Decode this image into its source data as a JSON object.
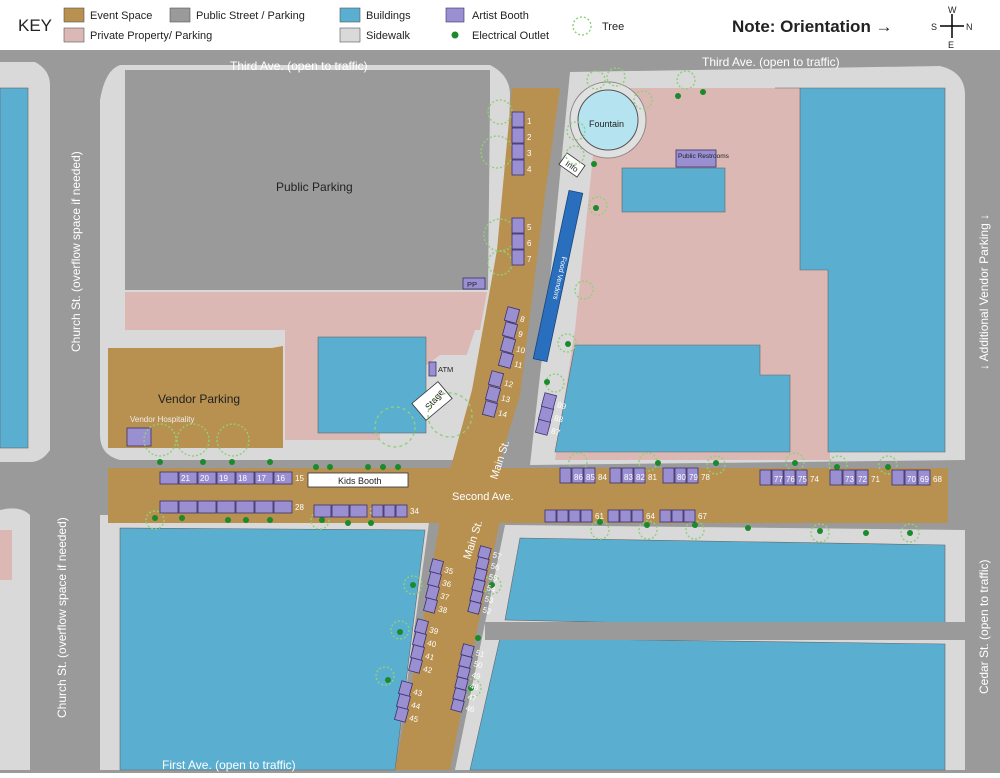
{
  "key": {
    "title": "KEY",
    "items": [
      {
        "label": "Event Space",
        "color": "#b8904f"
      },
      {
        "label": "Public Street / Parking",
        "color": "#9a9a9a"
      },
      {
        "label": "Buildings",
        "color": "#5aaed0"
      },
      {
        "label": "Artist Booth",
        "color": "#9a8fd0"
      },
      {
        "label": "Private Property/ Parking",
        "color": "#dcb8b4"
      },
      {
        "label": "Sidewalk",
        "color": "#d9d9d9"
      },
      {
        "label": "Electrical Outlet",
        "icon": "electrical-outlet-icon"
      },
      {
        "label": "Tree",
        "icon": "tree-icon"
      }
    ],
    "orientation_note": "Note: Orientation →",
    "compass": {
      "top": "W",
      "right": "N",
      "bottom": "E",
      "left": "S"
    }
  },
  "streets": {
    "third_ave_left": "Third Ave. (open to traffic)",
    "third_ave_right": "Third Ave. (open to traffic)",
    "first_ave": "First Ave. (open to traffic)",
    "church_st_top": "Church St. (overflow space if needed)",
    "church_st_bottom": "Church St. (overflow space if needed)",
    "cedar_st": "Cedar St. (open to traffic)",
    "additional_vendor": "↓ Additional Vendor Parking ↓",
    "second_ave": "Second Ave.",
    "main_st_upper": "Main St.",
    "main_st_lower": "Main St."
  },
  "places": {
    "public_parking": "Public Parking",
    "vendor_parking": "Vendor Parking",
    "vendor_hospitality": "Vendor Hospitality",
    "fountain": "Fountain",
    "info": "Info",
    "public_restrooms": "Public Restrooms",
    "food_vendors": "Food Vendors",
    "atm": "ATM",
    "stage": "Stage",
    "kids_booth": "Kids Booth",
    "pp": "PP"
  },
  "booths": [
    "1",
    "2",
    "3",
    "4",
    "5",
    "6",
    "7",
    "8",
    "9",
    "10",
    "11",
    "12",
    "13",
    "14",
    "15",
    "16",
    "17",
    "18",
    "19",
    "20",
    "21",
    "22",
    "23",
    "24",
    "25",
    "26",
    "27",
    "28",
    "29",
    "30",
    "31",
    "32",
    "33",
    "34",
    "35",
    "36",
    "37",
    "38",
    "39",
    "40",
    "41",
    "42",
    "43",
    "44",
    "45",
    "46",
    "47",
    "48",
    "49",
    "50",
    "51",
    "52",
    "53",
    "54",
    "55",
    "56",
    "57",
    "58",
    "59",
    "60",
    "61",
    "62",
    "63",
    "64",
    "65",
    "66",
    "67",
    "68",
    "69",
    "70",
    "71",
    "72",
    "73",
    "74",
    "75",
    "76",
    "77",
    "78",
    "79",
    "80",
    "81",
    "82",
    "83",
    "84",
    "85",
    "86",
    "87",
    "88",
    "89"
  ]
}
